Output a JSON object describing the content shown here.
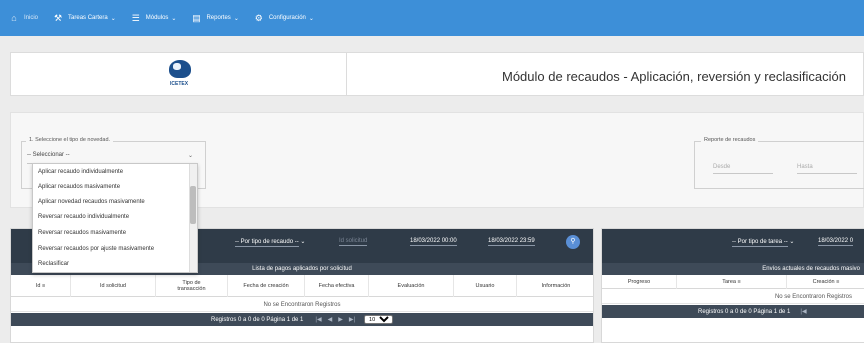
{
  "nav": {
    "items": [
      {
        "label": "Inicio",
        "icon": "home-icon"
      },
      {
        "label": "Tareas Cartera",
        "icon": "wrench-icon"
      },
      {
        "label": "Módulos",
        "icon": "menu-icon"
      },
      {
        "label": "Reportes",
        "icon": "report-icon"
      },
      {
        "label": "Configuración",
        "icon": "gear-icon"
      }
    ],
    "bar_color": "#3d8fd8"
  },
  "header": {
    "logo_text": "ICETEX",
    "title": "Módulo de recaudos - Aplicación, reversión y reclasificación"
  },
  "filters": {
    "novedad_legend": "1. Seleccione el tipo de novedad.",
    "novedad_select": "-- Seleccionar --",
    "reporte_legend": "Reporte de recaudos",
    "desde_placeholder": "Desde",
    "hasta_placeholder": "Hasta"
  },
  "dropdown": {
    "options": [
      "Aplicar recaudo individualmente",
      "Aplicar recaudos masivamente",
      "Aplicar novedad recaudos masivamente",
      "Reversar recaudo individualmente",
      "Reversar recaudos masivamente",
      "Reversar recaudos por ajuste masivamente",
      "Reclasificar"
    ]
  },
  "left_table": {
    "filter_select": "-- Por tipo de recaudo --",
    "solicitud_placeholder": "Id solicitud",
    "date_from": "18/03/2022 00:00",
    "date_to": "18/03/2022 23:59",
    "caption": "Lista de pagos aplicados por solicitud",
    "columns": [
      "Id",
      "Id solicitud",
      "Tipo de transacción",
      "Fecha de creación",
      "Fecha efectiva",
      "Evaluación",
      "Usuario",
      "Información"
    ],
    "empty_text": "No se Encontraron Registros",
    "pager_text": "Registros 0 a 0 de 0  Página 1 de 1",
    "page_size": "10"
  },
  "right_table": {
    "filter_select": "-- Por tipo de tarea --",
    "date": "18/03/2022 0",
    "caption": "Envíos actuales de recaudos masivo",
    "columns": [
      "Progreso",
      "Tarea",
      "Creación"
    ],
    "empty_text": "No se Encontraron Registros",
    "pager_text": "Registros 0 a 0 de 0  Página 1 de 1"
  }
}
